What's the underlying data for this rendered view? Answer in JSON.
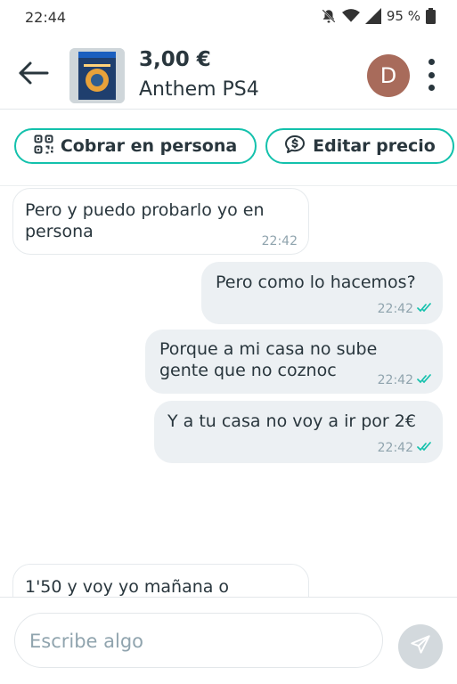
{
  "status_bar": {
    "time": "22:44",
    "battery": "95 %"
  },
  "header": {
    "price": "3,00 €",
    "title": "Anthem PS4",
    "avatar_letter": "D"
  },
  "actions": {
    "cobrar": "Cobrar en persona",
    "editar": "Editar precio"
  },
  "messages": [
    {
      "dir": "in",
      "lines": [
        "Pero y puedo probarlo yo en",
        "persona"
      ],
      "time": "22:42"
    },
    {
      "dir": "out",
      "lines": [
        "Pero como lo hacemos?"
      ],
      "time": "22:42"
    },
    {
      "dir": "out",
      "lines": [
        "Porque a mi casa no sube",
        "gente que no coznoc"
      ],
      "time": "22:42"
    },
    {
      "dir": "out",
      "lines": [
        "Y a tu casa no voy a ir por 2€"
      ],
      "time": "22:42"
    },
    {
      "dir": "in",
      "lines": [
        "1'50 y voy yo mañana o"
      ],
      "time": ""
    }
  ],
  "composer": {
    "placeholder": "Escribe algo"
  },
  "colors": {
    "accent": "#13c1ac",
    "outgoing_bubble": "#ecf0f3",
    "avatar": "#a86b5b"
  }
}
